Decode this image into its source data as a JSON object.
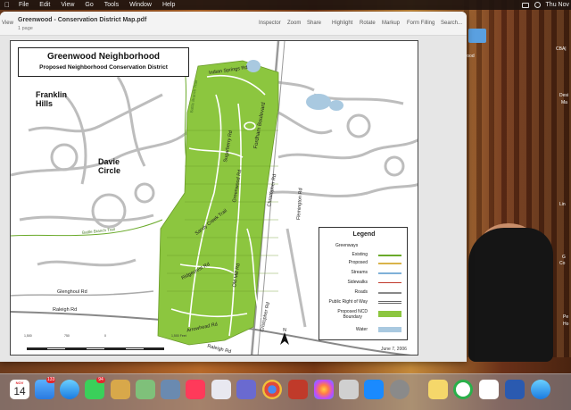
{
  "menubar": {
    "items": [
      "File",
      "Edit",
      "View",
      "Go",
      "Tools",
      "Window",
      "Help"
    ],
    "clock": "Thu Nov"
  },
  "window": {
    "view_label": "View",
    "title": "Greenwood - Conservation District Map.pdf",
    "subtitle": "1 page",
    "tools": [
      "Inspector",
      "Zoom",
      "Share",
      "Highlight",
      "Rotate",
      "Markup",
      "Form Filling",
      "Search..."
    ]
  },
  "map": {
    "title": "Greenwood Neighborhood",
    "subtitle": "Proposed Neighborhood Conservation District",
    "places": [
      "Franklin\nHills",
      "Davie\nCircle"
    ],
    "streets": [
      "Indian Springs Rd",
      "Fordham Boulevard",
      "Sugarberry Rd",
      "Greenwood Rd",
      "Christopher Rd",
      "Flemington Rd",
      "Sandy Creek Trail",
      "Old Mill Rd",
      "Ridgecrest Rd",
      "Cristopher Rd",
      "Arrowhead Rd",
      "Raleigh Rd",
      "Glenghoul Rd",
      "Raleigh Rd"
    ],
    "greenway_labels": [
      "Battle Branch Trail",
      "Battle Branch Trail"
    ],
    "legend": {
      "title": "Legend",
      "greenways_heading": "Greenways",
      "rows": [
        "Existing",
        "Proposed",
        "Streams",
        "Sidewalks",
        "Roads",
        "Public Right of Way",
        "Proposed NCD\nBoundary",
        "Water"
      ]
    },
    "scale_ticks": [
      "1,500",
      "750",
      "0",
      "1,500 Feet"
    ],
    "north_label": "N",
    "date": "June 7, 2006"
  },
  "desktop": {
    "labels": [
      "rwood",
      "CBA|",
      "Desi",
      "Ma",
      "Lin",
      "G",
      "Co",
      "Pe",
      "Ho"
    ]
  },
  "dock": {
    "calendar_month": "NOV",
    "calendar_day": "14",
    "mail_badge": "133",
    "messages_badge": "94"
  },
  "colors": {
    "ncd_green": "#8cc63f",
    "water": "#a9c9e0",
    "existing_greenway": "#6aaa2a",
    "proposed_greenway": "#d9b34a",
    "streams": "#7fb0d8",
    "sidewalks": "#c0392b",
    "roads": "#888888"
  }
}
